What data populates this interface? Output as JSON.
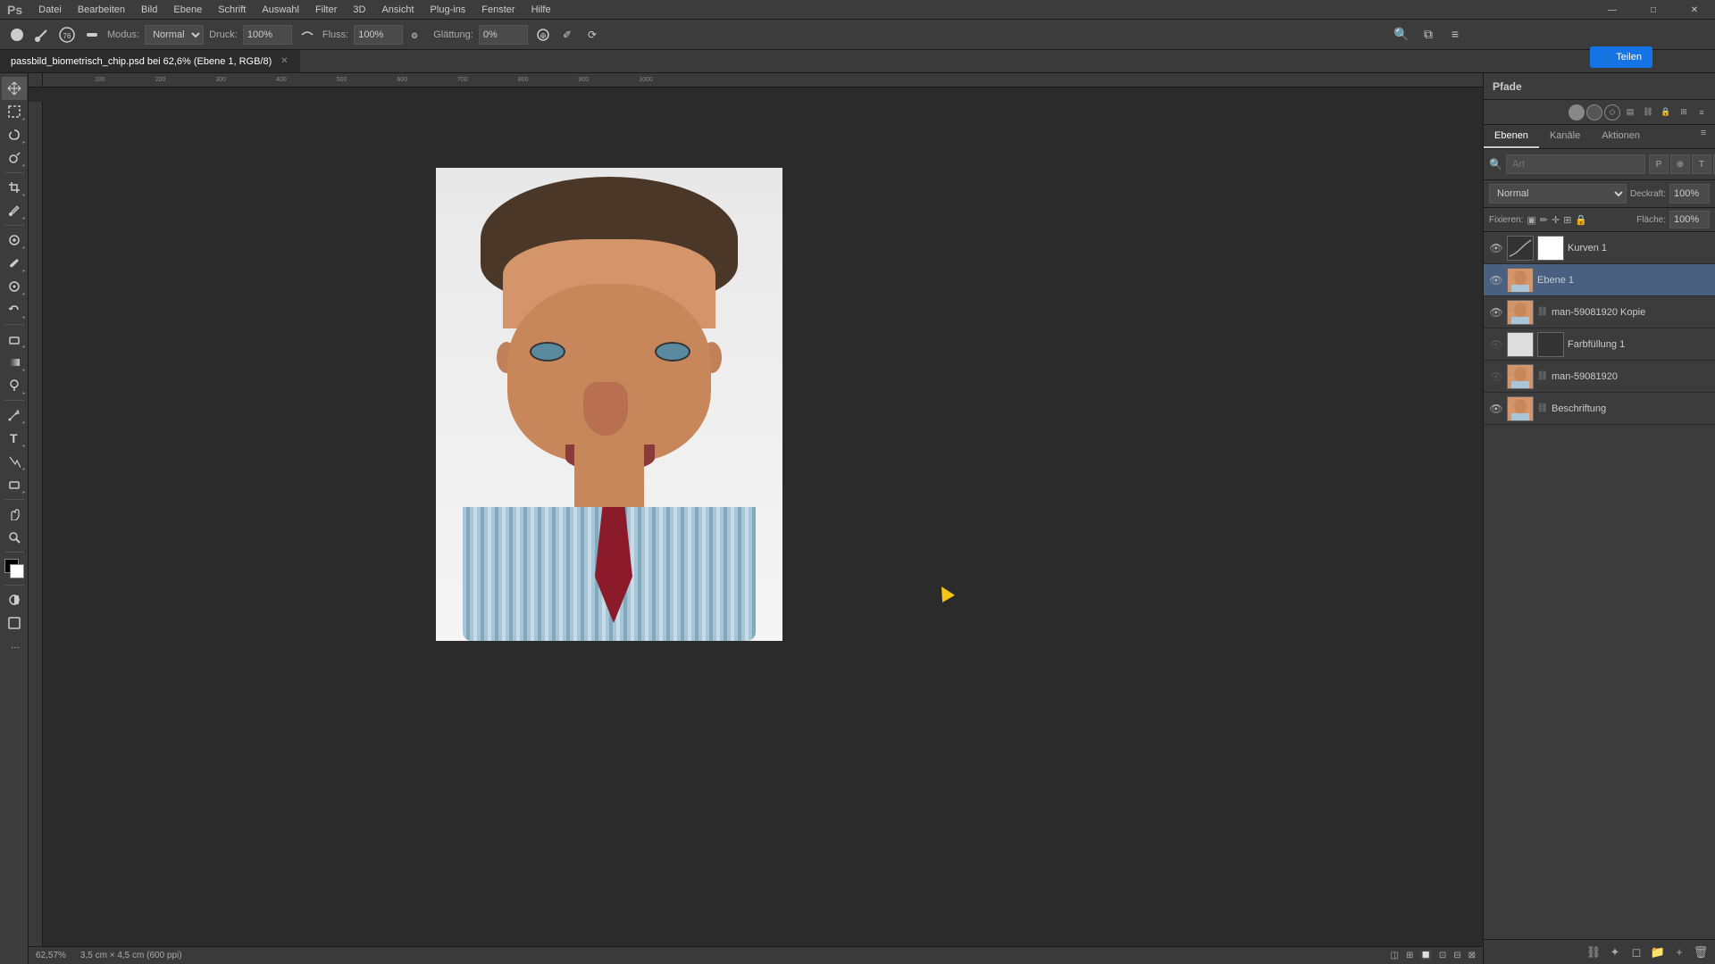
{
  "menubar": {
    "logo": "Ps",
    "items": [
      "Datei",
      "Bearbeiten",
      "Bild",
      "Ebene",
      "Schrift",
      "Auswahl",
      "Filter",
      "3D",
      "Ansicht",
      "Plug-ins",
      "Fenster",
      "Hilfe"
    ],
    "window_controls": [
      "—",
      "□",
      "✕"
    ]
  },
  "optionsbar": {
    "mode_label": "Modus:",
    "mode_value": "Normal",
    "druck_label": "Druck:",
    "druck_value": "100%",
    "fluss_label": "Fluss:",
    "fluss_value": "100%",
    "glattung_label": "Glättung:",
    "glattung_value": "0%",
    "share_label": "Teilen"
  },
  "tab": {
    "filename": "passbild_biometrisch_chip.psd bei 62,6% (Ebene 1, RGB/8)",
    "modified": true
  },
  "statusbar": {
    "zoom": "62,57%",
    "dimensions": "3,5 cm × 4,5 cm (600 ppi)"
  },
  "right_panel": {
    "pfade_title": "Pfade",
    "tabs": [
      "Ebenen",
      "Kanäle",
      "Aktionen"
    ],
    "mode_label": "Normal",
    "deckraft_label": "Deckraft:",
    "deckraft_value": "100%",
    "fixieren_label": "Fixieren:",
    "flache_label": "Fläche:",
    "flache_value": "100%",
    "layers": [
      {
        "name": "Kurven 1",
        "type": "adjustment",
        "visible": true,
        "selected": false
      },
      {
        "name": "Ebene 1",
        "type": "photo",
        "visible": true,
        "selected": true
      },
      {
        "name": "man-59081920 Kopie",
        "type": "photo_copy",
        "visible": true,
        "selected": false
      },
      {
        "name": "Farbfüllung 1",
        "type": "fill",
        "visible": false,
        "selected": false
      },
      {
        "name": "man-59081920",
        "type": "photo_orig",
        "visible": false,
        "selected": false
      },
      {
        "name": "Beschriftung",
        "type": "text",
        "visible": true,
        "selected": false
      }
    ]
  },
  "toolbar": {
    "tools": [
      {
        "name": "move",
        "icon": "✛",
        "has_sub": false
      },
      {
        "name": "select-rect",
        "icon": "▣",
        "has_sub": true
      },
      {
        "name": "lasso",
        "icon": "⟳",
        "has_sub": true
      },
      {
        "name": "quick-select",
        "icon": "⧉",
        "has_sub": true
      },
      {
        "name": "crop",
        "icon": "⊞",
        "has_sub": true
      },
      {
        "name": "eyedropper",
        "icon": "✐",
        "has_sub": true
      },
      {
        "name": "spot-heal",
        "icon": "⊕",
        "has_sub": true
      },
      {
        "name": "brush",
        "icon": "✏",
        "has_sub": true
      },
      {
        "name": "clone",
        "icon": "⊙",
        "has_sub": true
      },
      {
        "name": "history-brush",
        "icon": "↶",
        "has_sub": true
      },
      {
        "name": "eraser",
        "icon": "◻",
        "has_sub": true
      },
      {
        "name": "gradient",
        "icon": "▭",
        "has_sub": true
      },
      {
        "name": "dodge",
        "icon": "◯",
        "has_sub": true
      },
      {
        "name": "pen",
        "icon": "✒",
        "has_sub": true
      },
      {
        "name": "text",
        "icon": "T",
        "has_sub": true
      },
      {
        "name": "path-select",
        "icon": "↖",
        "has_sub": true
      },
      {
        "name": "shape",
        "icon": "▱",
        "has_sub": true
      },
      {
        "name": "hand",
        "icon": "✋",
        "has_sub": false
      },
      {
        "name": "zoom",
        "icon": "🔍",
        "has_sub": false
      }
    ]
  }
}
